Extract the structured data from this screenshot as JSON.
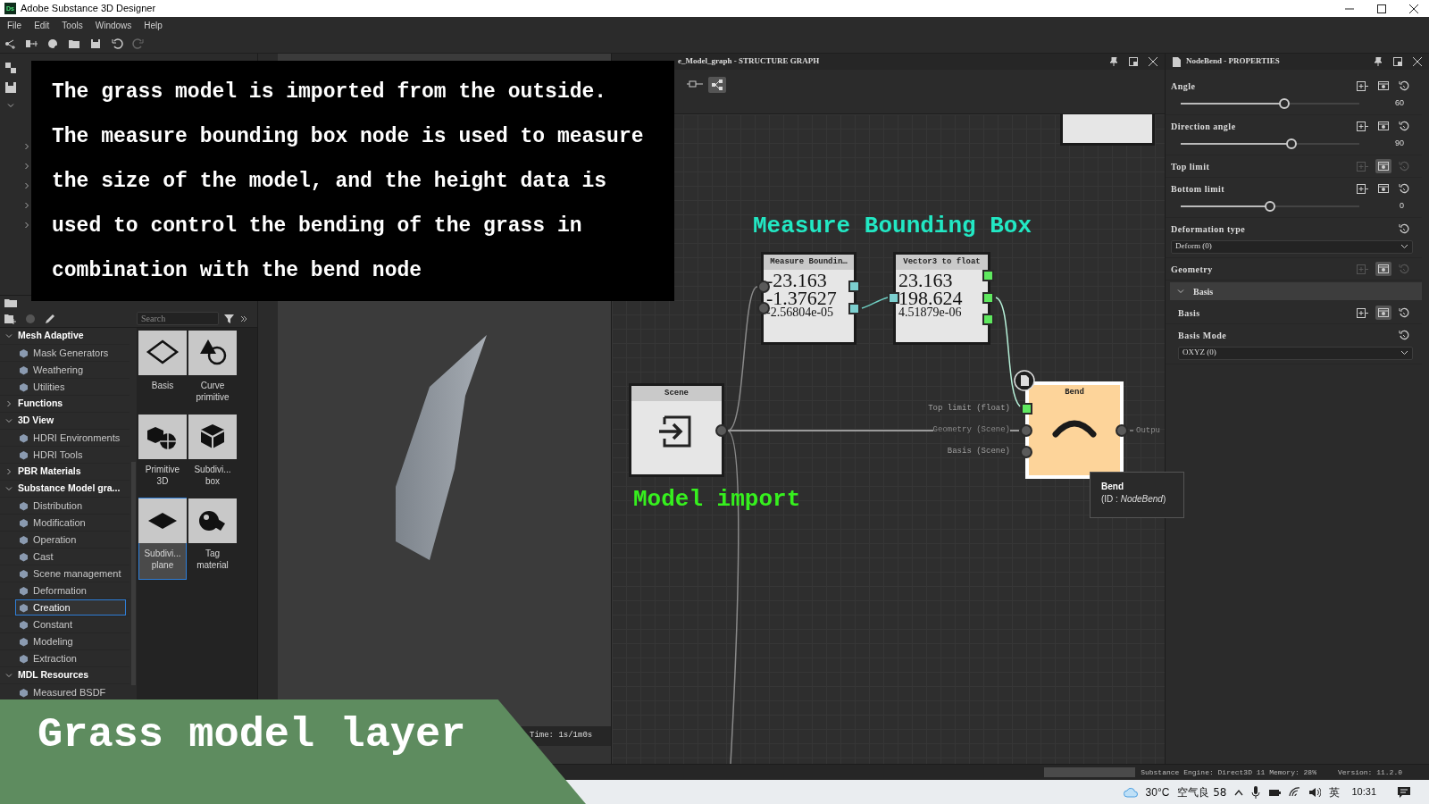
{
  "window": {
    "logo": "Ds",
    "title": "Adobe Substance 3D Designer"
  },
  "menu": [
    "File",
    "Edit",
    "Tools",
    "Windows",
    "Help"
  ],
  "caption": {
    "lines": [
      "The grass model is imported from the outside.",
      "The measure bounding box node is used to measure",
      "the size of the model, and the height data is",
      "used to control the bending of the grass in",
      "combination with the bend node"
    ]
  },
  "library": {
    "search": {
      "placeholder": "Search"
    },
    "tree": [
      {
        "label": "Mesh Adaptive",
        "expanded": true,
        "children": [
          {
            "label": "Mask Generators",
            "selected": false
          },
          {
            "label": "Weathering",
            "selected": false
          },
          {
            "label": "Utilities",
            "selected": false
          }
        ]
      },
      {
        "label": "Functions",
        "expanded": false
      },
      {
        "label": "3D View",
        "expanded": true,
        "children": [
          {
            "label": "HDRI Environments",
            "selected": false
          },
          {
            "label": "HDRI Tools",
            "selected": false
          }
        ]
      },
      {
        "label": "PBR Materials",
        "expanded": false
      },
      {
        "label": "Substance Model gra...",
        "expanded": true,
        "children": [
          {
            "label": "Distribution",
            "selected": false
          },
          {
            "label": "Modification",
            "selected": false
          },
          {
            "label": "Operation",
            "selected": false
          },
          {
            "label": "Cast",
            "selected": false
          },
          {
            "label": "Scene management",
            "selected": false
          },
          {
            "label": "Deformation",
            "selected": false
          },
          {
            "label": "Creation",
            "selected": true
          },
          {
            "label": "Constant",
            "selected": false
          },
          {
            "label": "Modeling",
            "selected": false
          },
          {
            "label": "Extraction",
            "selected": false
          }
        ]
      },
      {
        "label": "MDL Resources",
        "expanded": true,
        "children": [
          {
            "label": "Measured BSDF",
            "selected": false
          }
        ]
      }
    ],
    "tiles": [
      {
        "label": "Basis",
        "selected": false
      },
      {
        "label": "Curve primitive",
        "selected": false
      },
      {
        "label": "Primitive 3D",
        "selected": false
      },
      {
        "label": "Subdivi... box",
        "selected": false
      },
      {
        "label": "Subdivi... plane",
        "selected": true
      },
      {
        "label": "Tag material",
        "selected": false
      }
    ]
  },
  "viewport": {
    "time": "Time: 1s/1m0s"
  },
  "graph": {
    "title": "e_Model_graph - STRUCTURE GRAPH",
    "annotations": [
      {
        "text": "Measure Bounding Box",
        "color": "#22e8c4"
      },
      {
        "text": "Model import",
        "color": "#36f01e"
      }
    ],
    "nodes": [
      {
        "kind": "measure",
        "title": "Measure Boundin…",
        "values": [
          "-23.163",
          "-1.37627",
          "-2.56804e-05"
        ]
      },
      {
        "kind": "vector",
        "title": "Vector3 to float",
        "values": [
          "23.163",
          "198.624",
          "4.51879e-06"
        ]
      },
      {
        "kind": "scene",
        "title": "Scene"
      },
      {
        "kind": "bend",
        "title": "Bend",
        "inputs": [
          "Top limit (float)",
          "Geometry (Scene)",
          "Basis (Scene)"
        ],
        "output": "Outpu"
      }
    ],
    "tooltip": {
      "title": "Bend",
      "id": "(ID : *NodeBend*)"
    }
  },
  "properties": {
    "title": "NodeBend - PROPERTIES",
    "params": [
      {
        "kind": "slider",
        "label": "Angle",
        "level": 0.58,
        "value": "60",
        "full_controls": true,
        "exposed": false,
        "locked": false
      },
      {
        "kind": "slider",
        "label": "Direction angle",
        "level": 0.62,
        "value": "90",
        "full_controls": true,
        "exposed": false,
        "locked": false
      },
      {
        "kind": "plain",
        "label": "Top limit",
        "full_controls": true,
        "exposed": true,
        "locked": true
      },
      {
        "kind": "slider",
        "label": "Bottom limit",
        "level": 0.5,
        "value": "0",
        "full_controls": true,
        "exposed": false,
        "locked": false
      },
      {
        "kind": "dropdown",
        "label": "Deformation type",
        "value": "Deform (0)",
        "full_controls": false
      },
      {
        "kind": "plain",
        "label": "Geometry",
        "full_controls": true,
        "exposed": true,
        "locked": true
      },
      {
        "kind": "group",
        "label": "Basis",
        "expanded": true
      },
      {
        "kind": "plain",
        "label": "Basis",
        "full_controls": true,
        "exposed": true,
        "locked": false
      },
      {
        "kind": "dropdown",
        "label": "Basis Mode",
        "value": "OXYZ (0)",
        "full_controls": false
      }
    ]
  },
  "status_bar": {
    "engine": "Substance Engine: Direct3D 11 Memory: 28%",
    "version": "Version: 11.2.0"
  },
  "banner": {
    "text": "Grass model layer"
  },
  "taskbar": {
    "temperature": "30°C",
    "air": "空气良 58",
    "ime": "英",
    "time": "10:31"
  }
}
